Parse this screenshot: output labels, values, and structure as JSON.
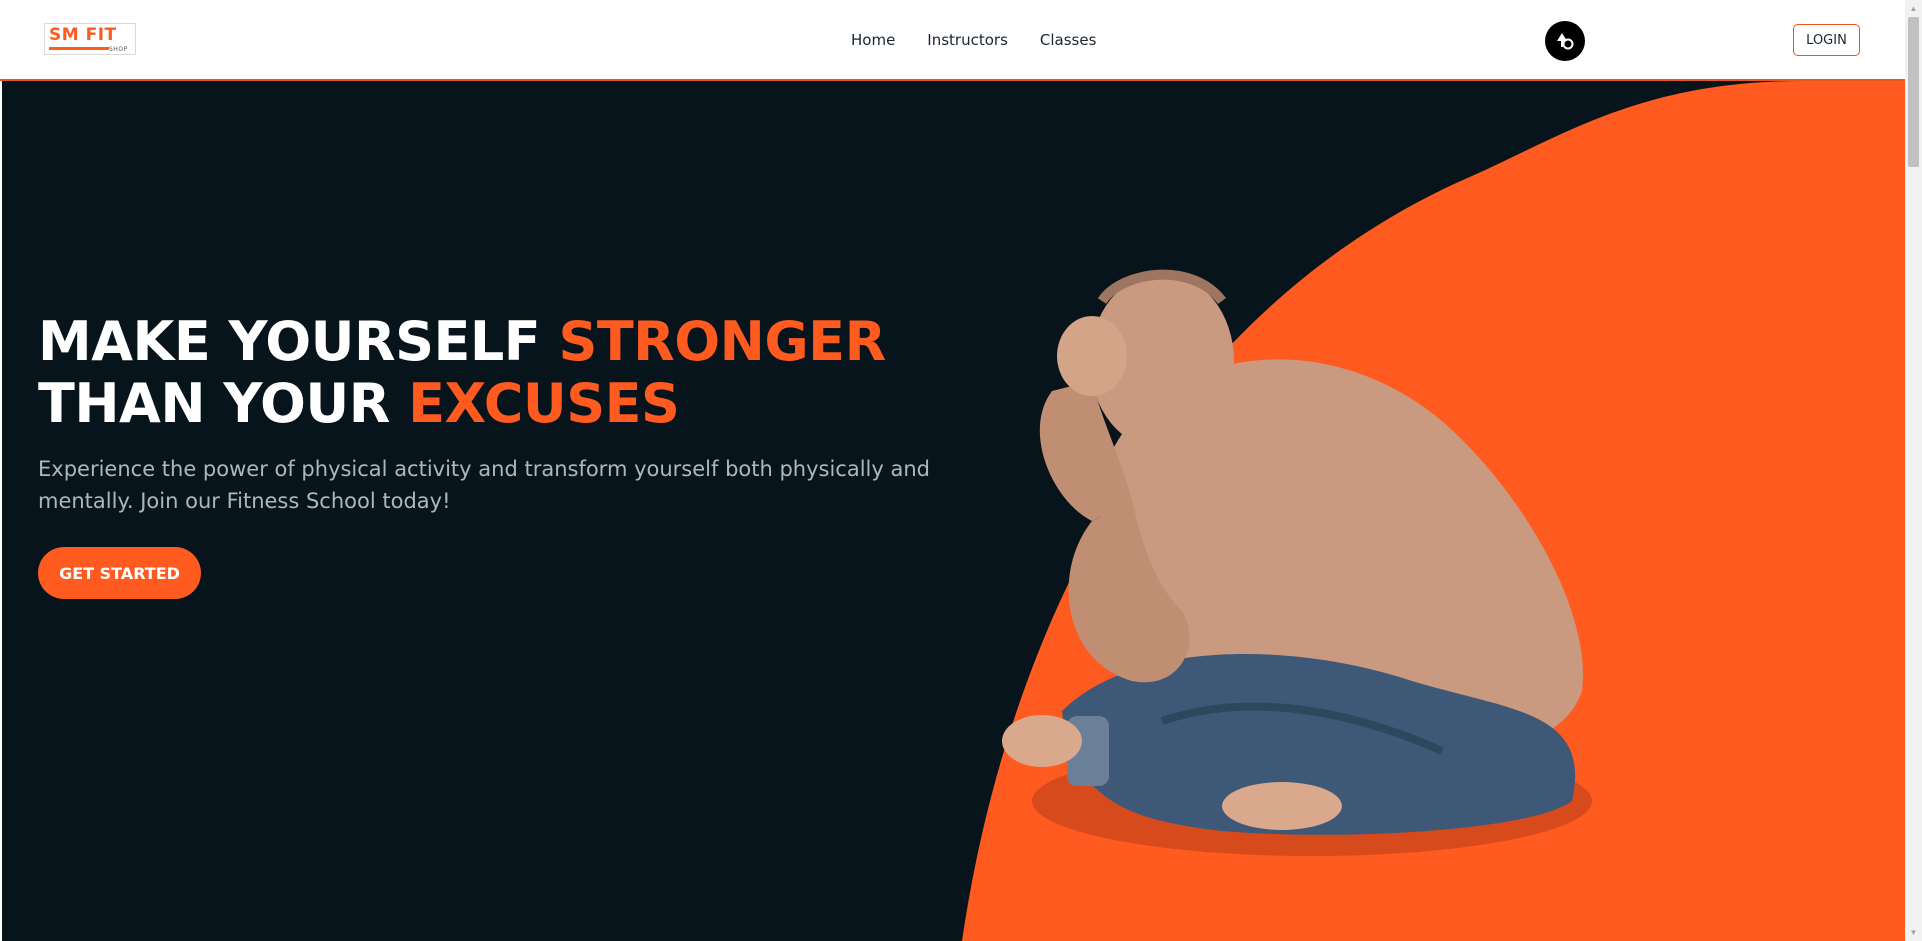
{
  "header": {
    "logo_main": "SM FIT",
    "logo_sub": "SHOP",
    "nav": [
      {
        "label": "Home"
      },
      {
        "label": "Instructors"
      },
      {
        "label": "Classes"
      }
    ],
    "login_label": "LOGIN"
  },
  "hero": {
    "title_line1": "MAKE YOURSELF ",
    "title_line1_accent": "STRONGER",
    "title_line2": "THAN YOUR ",
    "title_line2_accent": "EXCUSES",
    "subtitle": "Experience the power of physical activity and transform yourself both physically and mentally. Join our Fitness School today!",
    "cta_label": "GET STARTED"
  },
  "colors": {
    "accent": "#ff5a1f",
    "hero_bg": "#07141b",
    "header_bg": "#ffffff"
  },
  "icons": {
    "theme_toggle": "theme-toggle-icon",
    "scroll_up": "scroll-up-arrow-icon",
    "scroll_down": "scroll-down-arrow-icon"
  }
}
